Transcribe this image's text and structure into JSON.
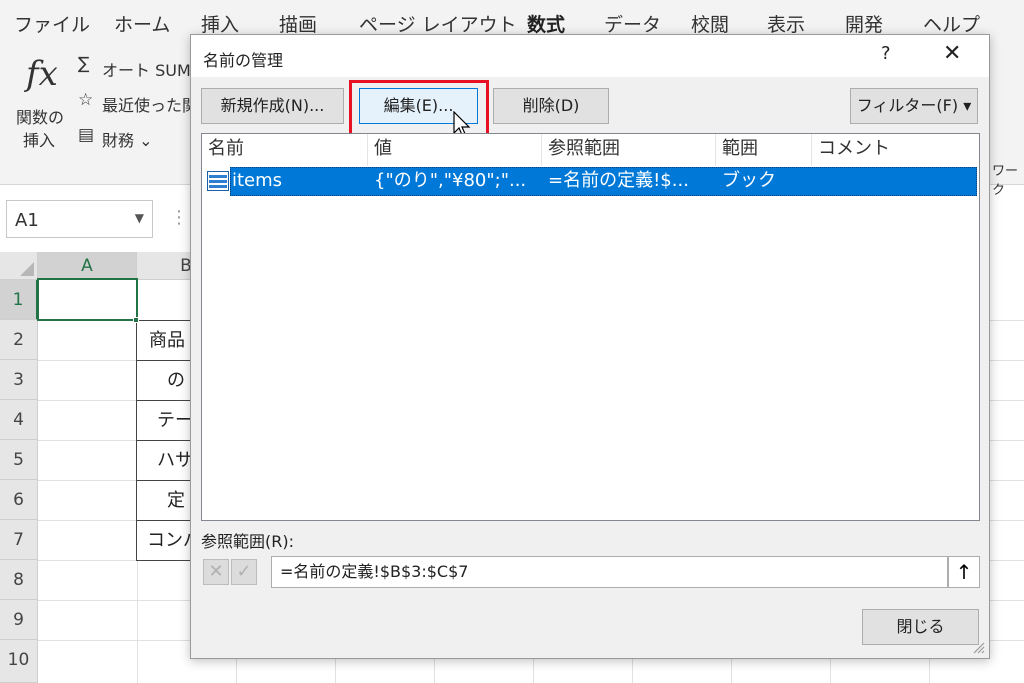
{
  "ribbon": {
    "tabs": [
      "ファイル",
      "ホーム",
      "挿入",
      "描画",
      "ページ レイアウト",
      "数式",
      "データ",
      "校閲",
      "表示",
      "開発",
      "ヘルプ"
    ],
    "active_tab": "数式",
    "fx_symbol": "fx",
    "insert_function_line1": "関数の",
    "insert_function_line2": "挿入",
    "autosum_label": "オート SUM",
    "recent_label": "最近使った関",
    "financial_label": "財務 ⌄",
    "worksheet_fragment": "ワーク"
  },
  "namebox": {
    "value": "A1"
  },
  "sheet": {
    "columns": [
      "A",
      "B"
    ],
    "rows": [
      "1",
      "2",
      "3",
      "4",
      "5",
      "6",
      "7",
      "8",
      "9",
      "10"
    ],
    "cells": [
      "商品",
      "の",
      "テー",
      "ハサ",
      "定",
      "コンバ"
    ]
  },
  "dialog": {
    "title": "名前の管理",
    "help": "?",
    "close": "✕",
    "buttons": {
      "new": "新規作成(N)...",
      "edit": "編集(E)...",
      "delete": "削除(D)",
      "filter": "フィルター(F) ▾"
    },
    "columns": [
      "名前",
      "値",
      "参照範囲",
      "範囲",
      "コメント"
    ],
    "rows": [
      {
        "name": "items",
        "value": "{\"のり\",\"¥80\";\"...",
        "refers_to": "=名前の定義!$...",
        "scope": "ブック",
        "comment": ""
      }
    ],
    "refers_to_label": "参照範囲(R):",
    "refers_to_value": "=名前の定義!$B$3:$C$7",
    "close_button": "閉じる"
  },
  "colors": {
    "accent": "#217346",
    "selection": "#0078d7",
    "highlight": "#e81123"
  }
}
